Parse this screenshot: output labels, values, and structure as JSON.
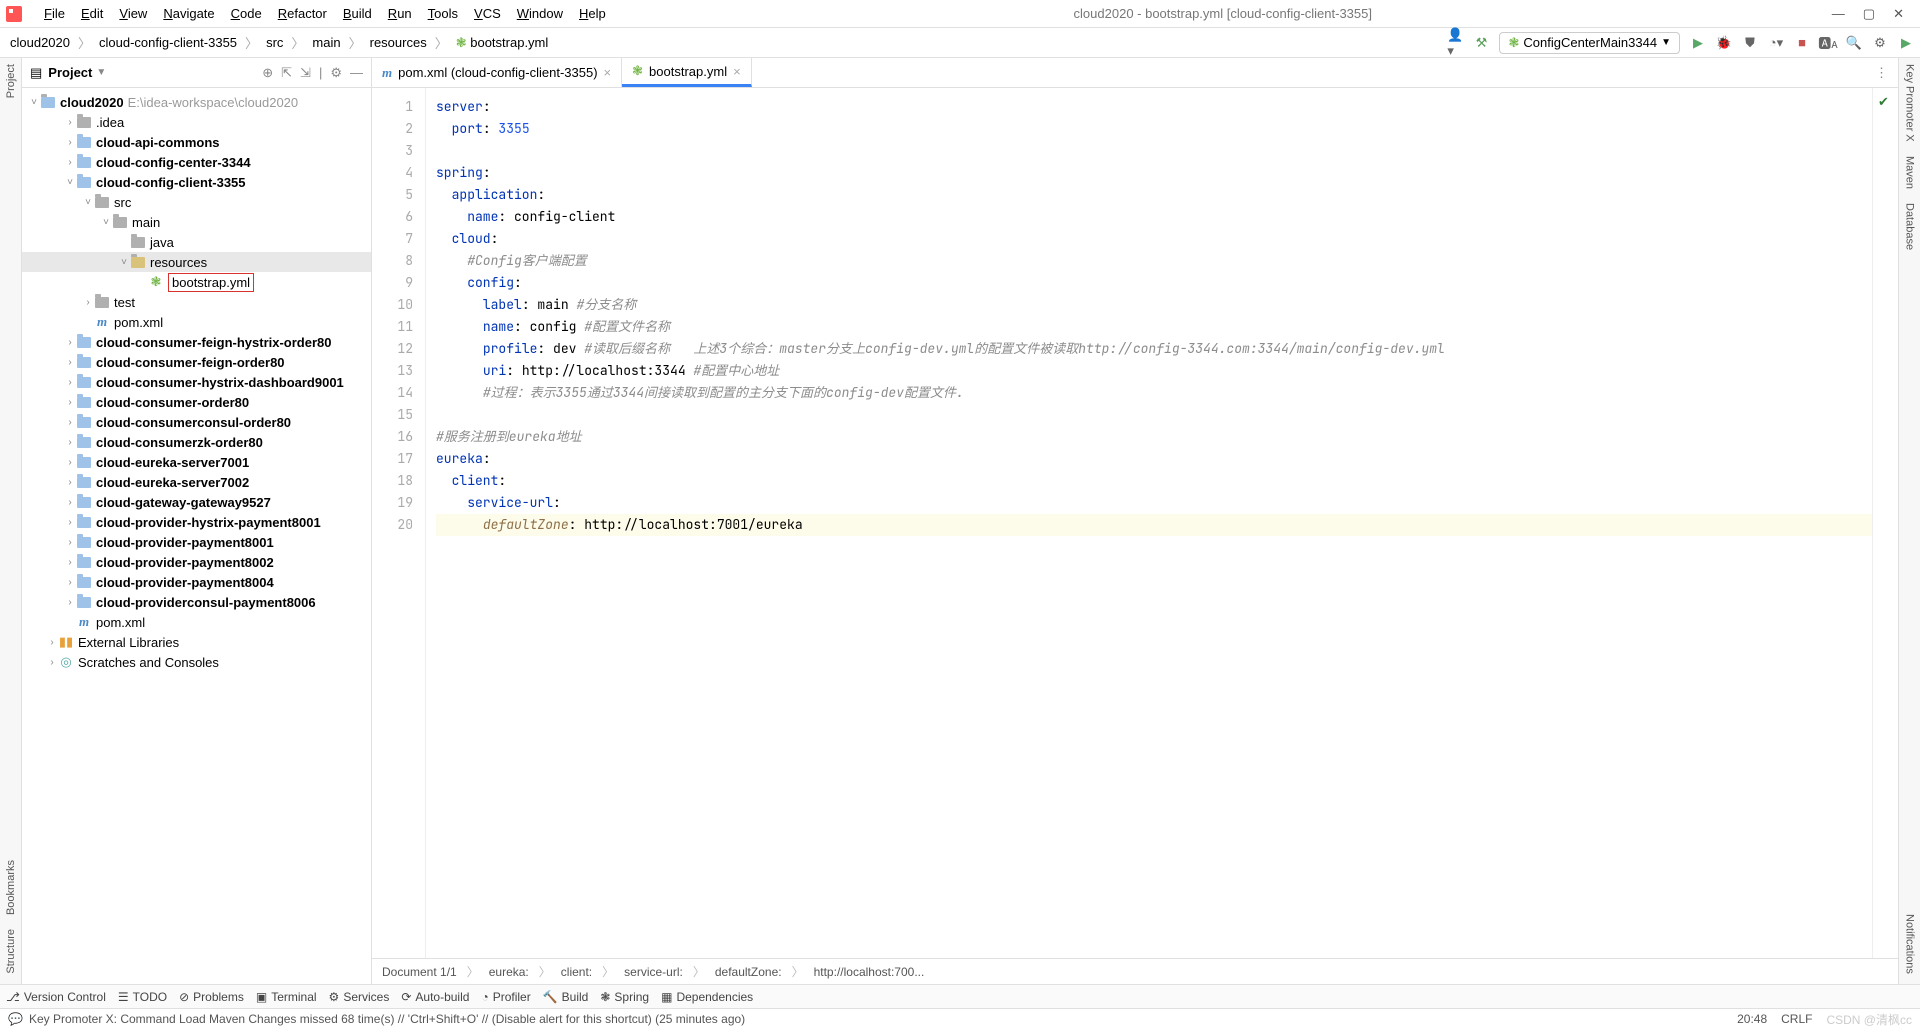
{
  "window_title": "cloud2020 - bootstrap.yml [cloud-config-client-3355]",
  "menus": [
    "File",
    "Edit",
    "View",
    "Navigate",
    "Code",
    "Refactor",
    "Build",
    "Run",
    "Tools",
    "VCS",
    "Window",
    "Help"
  ],
  "breadcrumbs": [
    "cloud2020",
    "cloud-config-client-3355",
    "src",
    "main",
    "resources",
    "bootstrap.yml"
  ],
  "run_config": "ConfigCenterMain3344",
  "project": {
    "label": "Project",
    "root": {
      "name": "cloud2020",
      "path": "E:\\idea-workspace\\cloud2020"
    },
    "items": [
      {
        "depth": 1,
        "arrow": ">",
        "type": "folder",
        "name": ".idea"
      },
      {
        "depth": 1,
        "arrow": ">",
        "type": "mod",
        "name": "cloud-api-commons",
        "bold": true
      },
      {
        "depth": 1,
        "arrow": ">",
        "type": "mod",
        "name": "cloud-config-center-3344",
        "bold": true
      },
      {
        "depth": 1,
        "arrow": "v",
        "type": "mod",
        "name": "cloud-config-client-3355",
        "bold": true
      },
      {
        "depth": 2,
        "arrow": "v",
        "type": "folder",
        "name": "src"
      },
      {
        "depth": 3,
        "arrow": "v",
        "type": "folder",
        "name": "main"
      },
      {
        "depth": 4,
        "arrow": "",
        "type": "folder",
        "name": "java"
      },
      {
        "depth": 4,
        "arrow": "v",
        "type": "res",
        "name": "resources",
        "selected": true
      },
      {
        "depth": 5,
        "arrow": "",
        "type": "yml",
        "name": "bootstrap.yml",
        "highlighted": true
      },
      {
        "depth": 2,
        "arrow": ">",
        "type": "folder",
        "name": "test"
      },
      {
        "depth": 2,
        "arrow": "",
        "type": "m",
        "name": "pom.xml"
      },
      {
        "depth": 1,
        "arrow": ">",
        "type": "mod",
        "name": "cloud-consumer-feign-hystrix-order80",
        "bold": true
      },
      {
        "depth": 1,
        "arrow": ">",
        "type": "mod",
        "name": "cloud-consumer-feign-order80",
        "bold": true
      },
      {
        "depth": 1,
        "arrow": ">",
        "type": "mod",
        "name": "cloud-consumer-hystrix-dashboard9001",
        "bold": true
      },
      {
        "depth": 1,
        "arrow": ">",
        "type": "mod",
        "name": "cloud-consumer-order80",
        "bold": true
      },
      {
        "depth": 1,
        "arrow": ">",
        "type": "mod",
        "name": "cloud-consumerconsul-order80",
        "bold": true
      },
      {
        "depth": 1,
        "arrow": ">",
        "type": "mod",
        "name": "cloud-consumerzk-order80",
        "bold": true
      },
      {
        "depth": 1,
        "arrow": ">",
        "type": "mod",
        "name": "cloud-eureka-server7001",
        "bold": true
      },
      {
        "depth": 1,
        "arrow": ">",
        "type": "mod",
        "name": "cloud-eureka-server7002",
        "bold": true
      },
      {
        "depth": 1,
        "arrow": ">",
        "type": "mod",
        "name": "cloud-gateway-gateway9527",
        "bold": true
      },
      {
        "depth": 1,
        "arrow": ">",
        "type": "mod",
        "name": "cloud-provider-hystrix-payment8001",
        "bold": true
      },
      {
        "depth": 1,
        "arrow": ">",
        "type": "mod",
        "name": "cloud-provider-payment8001",
        "bold": true
      },
      {
        "depth": 1,
        "arrow": ">",
        "type": "mod",
        "name": "cloud-provider-payment8002",
        "bold": true
      },
      {
        "depth": 1,
        "arrow": ">",
        "type": "mod",
        "name": "cloud-provider-payment8004",
        "bold": true
      },
      {
        "depth": 1,
        "arrow": ">",
        "type": "mod",
        "name": "cloud-providerconsul-payment8006",
        "bold": true
      },
      {
        "depth": 1,
        "arrow": "",
        "type": "m",
        "name": "pom.xml"
      },
      {
        "depth": 0,
        "arrow": ">",
        "type": "lib",
        "name": "External Libraries"
      },
      {
        "depth": 0,
        "arrow": ">",
        "type": "scratch",
        "name": "Scratches and Consoles"
      }
    ]
  },
  "tabs": [
    {
      "icon": "m",
      "label": "pom.xml (cloud-config-client-3355)",
      "active": false
    },
    {
      "icon": "yml",
      "label": "bootstrap.yml",
      "active": true
    }
  ],
  "code_lines": [
    {
      "n": 1,
      "html": "<span class='kw'>server</span>:"
    },
    {
      "n": 2,
      "html": "  <span class='kw'>port</span>: <span class='num'>3355</span>"
    },
    {
      "n": 3,
      "html": ""
    },
    {
      "n": 4,
      "html": "<span class='kw'>spring</span>:"
    },
    {
      "n": 5,
      "html": "  <span class='kw'>application</span>:"
    },
    {
      "n": 6,
      "html": "    <span class='kw'>name</span>: config-client"
    },
    {
      "n": 7,
      "html": "  <span class='kw'>cloud</span>:"
    },
    {
      "n": 8,
      "html": "    <span class='cmt'>#Config客户端配置</span>"
    },
    {
      "n": 9,
      "html": "    <span class='kw'>config</span>:"
    },
    {
      "n": 10,
      "html": "      <span class='kw'>label</span>: main <span class='cmt'>#分支名称</span>"
    },
    {
      "n": 11,
      "html": "      <span class='kw'>name</span>: config <span class='cmt'>#配置文件名称</span>"
    },
    {
      "n": 12,
      "html": "      <span class='kw'>profile</span>: dev <span class='cmt'>#读取后缀名称   上述3个综合：master分支上config-dev.yml的配置文件被读取http://config-3344.com:3344/main/config-dev.yml</span>"
    },
    {
      "n": 13,
      "html": "      <span class='kw'>uri</span>: http://localhost:3344 <span class='cmt'>#配置中心地址</span>"
    },
    {
      "n": 14,
      "html": "      <span class='cmt'>#过程：表示3355通过3344间接读取到配置的主分支下面的config-dev配置文件.</span>"
    },
    {
      "n": 15,
      "html": ""
    },
    {
      "n": 16,
      "html": "<span class='cmt'>#服务注册到eureka地址</span>"
    },
    {
      "n": 17,
      "html": "<span class='kw'>eureka</span>:"
    },
    {
      "n": 18,
      "html": "  <span class='kw'>client</span>:"
    },
    {
      "n": 19,
      "html": "    <span class='kw'>service-url</span>:"
    },
    {
      "n": 20,
      "html": "      <span class='key'>defaultZone</span>: http://localhost:7001/eureka",
      "hl": true
    }
  ],
  "doc_breadcrumb": [
    "Document 1/1",
    "eureka:",
    "client:",
    "service-url:",
    "defaultZone:",
    "http://localhost:700..."
  ],
  "bottom_tools": [
    "Version Control",
    "TODO",
    "Problems",
    "Terminal",
    "Services",
    "Auto-build",
    "Profiler",
    "Build",
    "Spring",
    "Dependencies"
  ],
  "status_msg": "Key Promoter X: Command Load Maven Changes missed 68 time(s) // 'Ctrl+Shift+O' // (Disable alert for this shortcut) (25 minutes ago)",
  "status_right": {
    "time": "20:48",
    "enc": "CRLF"
  },
  "left_labels": [
    "Project",
    "Bookmarks",
    "Structure"
  ],
  "right_labels": [
    "Key Promoter X",
    "Maven",
    "Database",
    "Notifications"
  ]
}
